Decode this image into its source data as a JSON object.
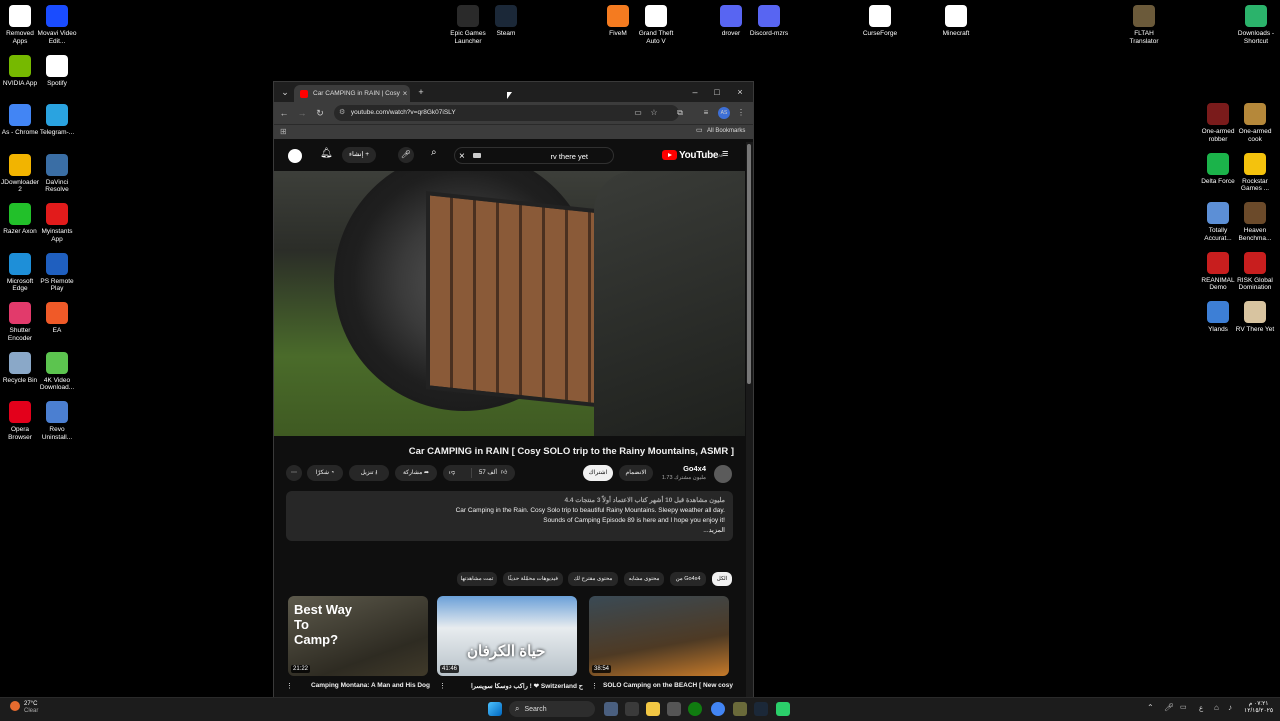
{
  "desktop_icons": [
    {
      "label": "Removed Apps",
      "color": "#ffffff"
    },
    {
      "label": "Movavi Video Edit...",
      "color": "#1a4cff"
    },
    {
      "label": "NVIDIA App",
      "color": "#76b900"
    },
    {
      "label": "Spotify",
      "color": "#ffffff"
    },
    {
      "label": "As - Chrome",
      "color": "#4285f4"
    },
    {
      "label": "Telegram-...",
      "color": "#2aa3e0"
    },
    {
      "label": "JDownloader 2",
      "color": "#f2b400"
    },
    {
      "label": "DaVinci Resolve",
      "color": "#3a6ea5"
    },
    {
      "label": "Razer Axon",
      "color": "#22c02a"
    },
    {
      "label": "Myinstants App",
      "color": "#e21b1b"
    },
    {
      "label": "Microsoft Edge",
      "color": "#1e8fd8"
    },
    {
      "label": "PS Remote Play",
      "color": "#1f5fbf"
    },
    {
      "label": "Shutter Encoder",
      "color": "#e23a6b"
    },
    {
      "label": "EA",
      "color": "#f05a28"
    },
    {
      "label": "Recycle Bin",
      "color": "#8aa8c8"
    },
    {
      "label": "4K Video Download...",
      "color": "#5cc44f"
    },
    {
      "label": "Opera Browser",
      "color": "#e3001b"
    },
    {
      "label": "Revo Uninstall...",
      "color": "#4b7fd1"
    }
  ],
  "top_icons": [
    {
      "label": "Epic Games Launcher"
    },
    {
      "label": "Steam"
    },
    {
      "label": "FiveM"
    },
    {
      "label": "Grand Theft Auto V"
    },
    {
      "label": "drover"
    },
    {
      "label": "Discord-mzrs"
    },
    {
      "label": "CurseForge"
    },
    {
      "label": "Minecraft"
    },
    {
      "label": "FLTAH Translator"
    },
    {
      "label": "Downloads - Shortcut"
    }
  ],
  "right_icons": [
    {
      "label": "One-armed robber"
    },
    {
      "label": "One-armed cook"
    },
    {
      "label": "Delta Force"
    },
    {
      "label": "Rockstar Games ..."
    },
    {
      "label": "Totally Accurat..."
    },
    {
      "label": "Heaven Benchma..."
    },
    {
      "label": "REANIMAL Demo"
    },
    {
      "label": "RISK Global Domination"
    },
    {
      "label": "Ylands"
    },
    {
      "label": "RV There Yet"
    }
  ],
  "browser": {
    "tab_title": "Car CAMPING in RAIN | Cosy S",
    "url": "youtube.com/watch?v=qr8Gk07iSLY",
    "bookmarks_label": "All Bookmarks"
  },
  "youtube": {
    "search_value": "rv there yet",
    "logo_text": "YouTube",
    "logo_sup": "AE",
    "create_label": "إنشاء",
    "video_title": "Car CAMPING in RAIN [ Cosy SOLO trip to the Rainy Mountains, ASMR ]",
    "channel_name": "Go4x4",
    "subscribers": "1.73 مليون مشترك",
    "subscribe_label": "اشتراك",
    "join_label": "الانضمام",
    "likes": "57 ألف",
    "share_label": "مشاركة",
    "download_label": "تنزيل",
    "thanks_label": "شكرًا",
    "desc_meta": "4.4 مليون مشاهدة قبل 10 أشهر  كتاب الاعتماد أولاً 3 منتجات",
    "desc_line1": "Car Camping in the Rain. Cosy Solo trip to beautiful Rainy Mountains. Sleepy weather all day.",
    "desc_line2": "Sounds of Camping Episode 89 is here and I hope you enjoy it!",
    "desc_more": "...المزيد",
    "chips": [
      "الكل",
      "من Go4x4",
      "محتوى مشابه",
      "محتوى مقترح لك",
      "فيديوهات محمّلة حديثًا",
      "تمت مشاهدتها"
    ],
    "related": [
      {
        "duration": "21:22",
        "title": "Camping Montana: A Man and His Dog",
        "overlay": "Best Way To Camp?"
      },
      {
        "duration": "41:46",
        "title": "راكب دوسكا سويسرا ! ❤ Switzerland ح",
        "overlay": "حياة الكرفان"
      },
      {
        "duration": "38:54",
        "title": "SOLO Camping on the BEACH [ New cosy",
        "overlay": ""
      }
    ]
  },
  "taskbar": {
    "weather_temp": "27°C",
    "weather_desc": "Clear",
    "search_label": "Search",
    "time": "٠٧:٢١ م",
    "date": "١٢/١٥/٢٠٢٥",
    "lang": "ع"
  }
}
